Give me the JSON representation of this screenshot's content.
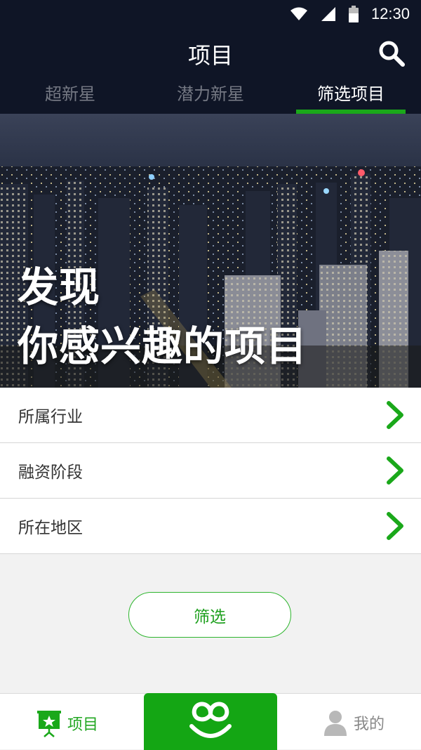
{
  "status_bar": {
    "time": "12:30"
  },
  "header": {
    "title": "项目"
  },
  "tabs": [
    {
      "label": "超新星",
      "active": false
    },
    {
      "label": "潜力新星",
      "active": false
    },
    {
      "label": "筛选项目",
      "active": true
    }
  ],
  "hero": {
    "line1": "发现",
    "line2": "你感兴趣的项目"
  },
  "filters": [
    {
      "label": "所属行业"
    },
    {
      "label": "融资阶段"
    },
    {
      "label": "所在地区"
    }
  ],
  "filter_button": {
    "label": "筛选"
  },
  "bottom_nav": {
    "projects_label": "项目",
    "mine_label": "我的"
  },
  "colors": {
    "accent_green": "#1aa81a",
    "header_bg": "#0f1526"
  },
  "icons": [
    "wifi-icon",
    "signal-icon",
    "battery-icon",
    "search-icon",
    "chevron-right-icon",
    "presentation-star-icon",
    "smile-logo-icon",
    "user-icon"
  ]
}
